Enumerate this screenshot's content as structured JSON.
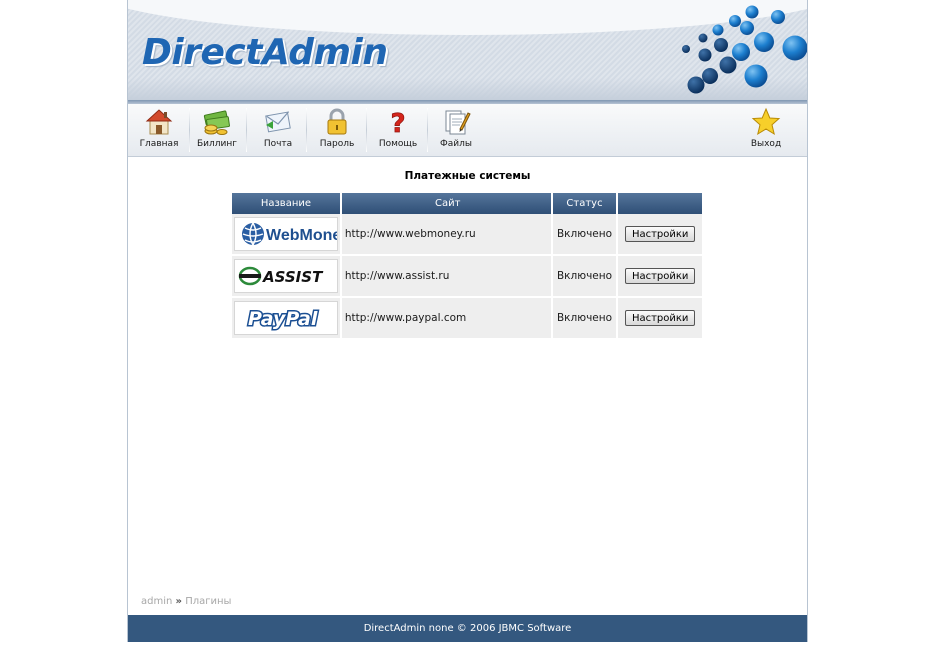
{
  "app": {
    "logo_text": "DirectAdmin"
  },
  "toolbar": {
    "items": [
      {
        "label": "Главная",
        "icon": "home-icon"
      },
      {
        "label": "Биллинг",
        "icon": "money-icon"
      },
      {
        "label": "Почта",
        "icon": "mail-icon"
      },
      {
        "label": "Пароль",
        "icon": "lock-icon"
      },
      {
        "label": "Помощь",
        "icon": "question-icon"
      },
      {
        "label": "Файлы",
        "icon": "files-icon"
      }
    ],
    "logout": {
      "label": "Выход",
      "icon": "star-icon"
    }
  },
  "main": {
    "title": "Платежные системы",
    "table": {
      "headers": [
        "Название",
        "Сайт",
        "Статус",
        ""
      ],
      "rows": [
        {
          "logo": "WebMoney",
          "site": "http://www.webmoney.ru",
          "status": "Включено",
          "action": "Настройки"
        },
        {
          "logo": "ASSIST",
          "site": "http://www.assist.ru",
          "status": "Включено",
          "action": "Настройки"
        },
        {
          "logo": "PayPal",
          "site": "http://www.paypal.com",
          "status": "Включено",
          "action": "Настройки"
        }
      ]
    }
  },
  "breadcrumb": {
    "items": [
      "admin",
      "Плагины"
    ],
    "separator": "»"
  },
  "footer": {
    "text": "DirectAdmin none © 2006 JBMC Software"
  },
  "colors": {
    "header_bar": "#2f4f76",
    "footer": "#34587f",
    "logo": "#1f66b3"
  }
}
